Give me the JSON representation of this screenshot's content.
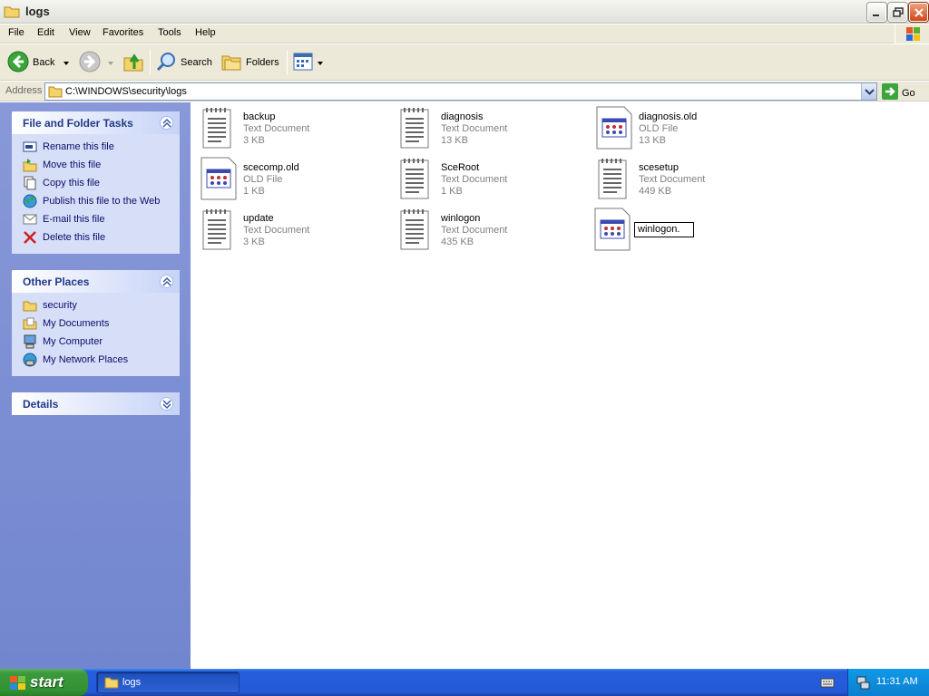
{
  "window": {
    "title": "logs"
  },
  "menu": [
    "File",
    "Edit",
    "View",
    "Favorites",
    "Tools",
    "Help"
  ],
  "toolbar": {
    "back": "Back",
    "search": "Search",
    "folders": "Folders"
  },
  "address": {
    "label": "Address",
    "path": "C:\\WINDOWS\\security\\logs",
    "go": "Go"
  },
  "tasks_panel": {
    "title": "File and Folder Tasks",
    "items": [
      "Rename this file",
      "Move this file",
      "Copy this file",
      "Publish this file to the Web",
      "E-mail this file",
      "Delete this file"
    ]
  },
  "places_panel": {
    "title": "Other Places",
    "items": [
      "security",
      "My Documents",
      "My Computer",
      "My Network Places"
    ]
  },
  "details_panel": {
    "title": "Details"
  },
  "files": [
    {
      "name": "backup",
      "type": "Text Document",
      "size": "3 KB",
      "icon": "text-document-icon"
    },
    {
      "name": "diagnosis",
      "type": "Text Document",
      "size": "13 KB",
      "icon": "text-document-icon"
    },
    {
      "name": "diagnosis.old",
      "type": "OLD File",
      "size": "13 KB",
      "icon": "old-file-icon"
    },
    {
      "name": "scecomp.old",
      "type": "OLD File",
      "size": "1 KB",
      "icon": "old-file-icon"
    },
    {
      "name": "SceRoot",
      "type": "Text Document",
      "size": "1 KB",
      "icon": "text-document-icon"
    },
    {
      "name": "scesetup",
      "type": "Text Document",
      "size": "449 KB",
      "icon": "text-document-icon"
    },
    {
      "name": "update",
      "type": "Text Document",
      "size": "3 KB",
      "icon": "text-document-icon"
    },
    {
      "name": "winlogon",
      "type": "Text Document",
      "size": "435 KB",
      "icon": "text-document-icon"
    }
  ],
  "rename_file": {
    "value": "winlogon.",
    "icon": "old-file-icon"
  },
  "taskbar": {
    "start": "start",
    "task": "logs",
    "clock": "11:31 AM"
  },
  "colors": {
    "taskpane": "#7c8fd0",
    "panel_bg": "#d6dff7",
    "taskbar": "#245edb",
    "start": "#3c9a3c",
    "link": "#0c0c6a"
  }
}
